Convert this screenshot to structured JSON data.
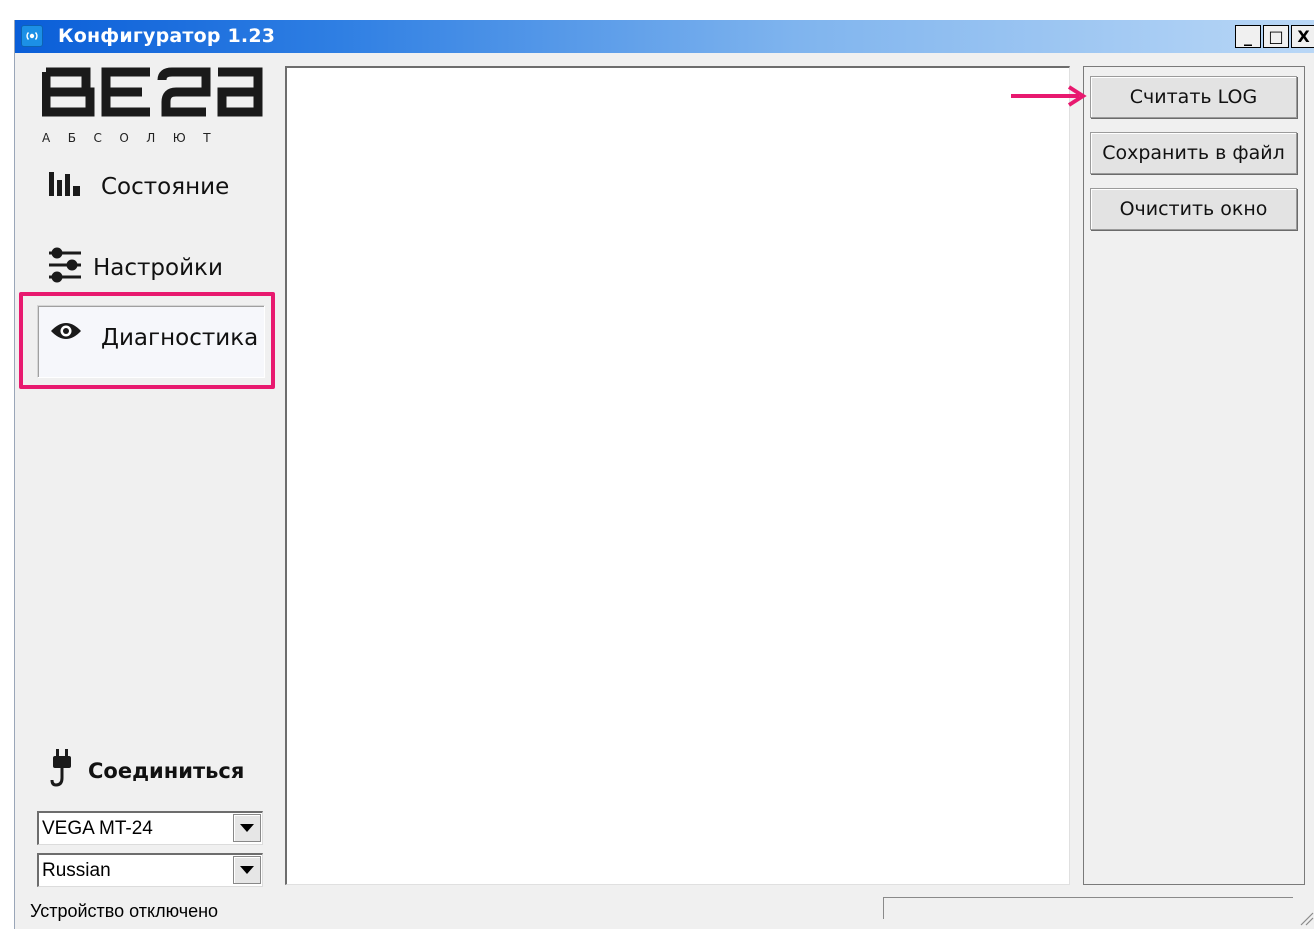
{
  "window": {
    "title": "Конфигуратор 1.23",
    "controls": {
      "minimize": "_",
      "maximize": "□",
      "close": "X"
    }
  },
  "logo": {
    "brand": "ВЕГА",
    "subtitle": "АБСОЛЮТ"
  },
  "sidebar": {
    "items": [
      {
        "label": "Состояние",
        "icon": "bar-chart-icon"
      },
      {
        "label": "Настройки",
        "icon": "sliders-icon"
      },
      {
        "label": "Диагностика",
        "icon": "eye-icon",
        "selected": true
      }
    ],
    "connect_label": "Соединиться",
    "device_select": {
      "value": "VEGA MT-24"
    },
    "language_select": {
      "value": "Russian"
    }
  },
  "actions": {
    "read_log": "Считать LOG",
    "save_file": "Сохранить в файл",
    "clear_window": "Очистить окно"
  },
  "status": {
    "text": "Устройство отключено"
  },
  "colors": {
    "highlight": "#e8196f",
    "titlebar_start": "#0a5ed8",
    "titlebar_end": "#b9d7f6"
  }
}
